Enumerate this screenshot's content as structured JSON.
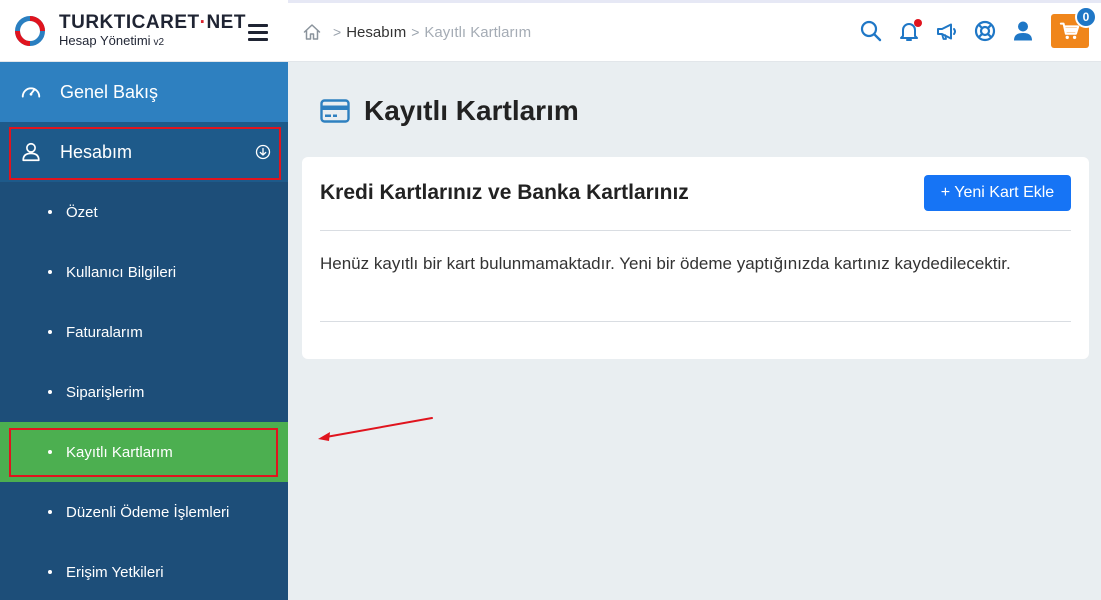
{
  "brand": {
    "name_main": "TURKTICARET",
    "name_dot": "·",
    "name_tld": "NET",
    "subtitle": "Hesap Yönetimi",
    "version": "v2"
  },
  "sidebar": {
    "overview_label": "Genel Bakış",
    "account_label": "Hesabım",
    "sub_items": [
      {
        "label": "Özet"
      },
      {
        "label": "Kullanıcı Bilgileri"
      },
      {
        "label": "Faturalarım"
      },
      {
        "label": "Siparişlerim"
      },
      {
        "label": "Kayıtlı Kartlarım"
      },
      {
        "label": "Düzenli Ödeme İşlemleri"
      },
      {
        "label": "Erişim Yetkileri"
      }
    ],
    "active_item": "Kayıtlı Kartlarım"
  },
  "breadcrumb": {
    "items": [
      "Hesabım",
      "Kayıtlı Kartlarım"
    ]
  },
  "topbar": {
    "icons": [
      "search-icon",
      "bell-icon",
      "megaphone-icon",
      "support-icon",
      "user-icon",
      "cart-icon"
    ],
    "cart_count": "0"
  },
  "page": {
    "title": "Kayıtlı Kartlarım"
  },
  "card": {
    "title": "Kredi Kartlarınız ve Banka Kartlarınız",
    "add_button": "+ Yeni Kart Ekle",
    "empty_message": "Henüz kayıtlı bir kart bulunmamaktadır. Yeni bir ödeme yaptığınızda kartınız kaydedilecektir."
  },
  "colors": {
    "sidebar_bg": "#1d4e79",
    "overview_bg": "#2e80c0",
    "active_bg": "#4caf50",
    "primary_button": "#1674f5",
    "cart_bg": "#f0861b",
    "annotation_red": "#e0141e"
  }
}
